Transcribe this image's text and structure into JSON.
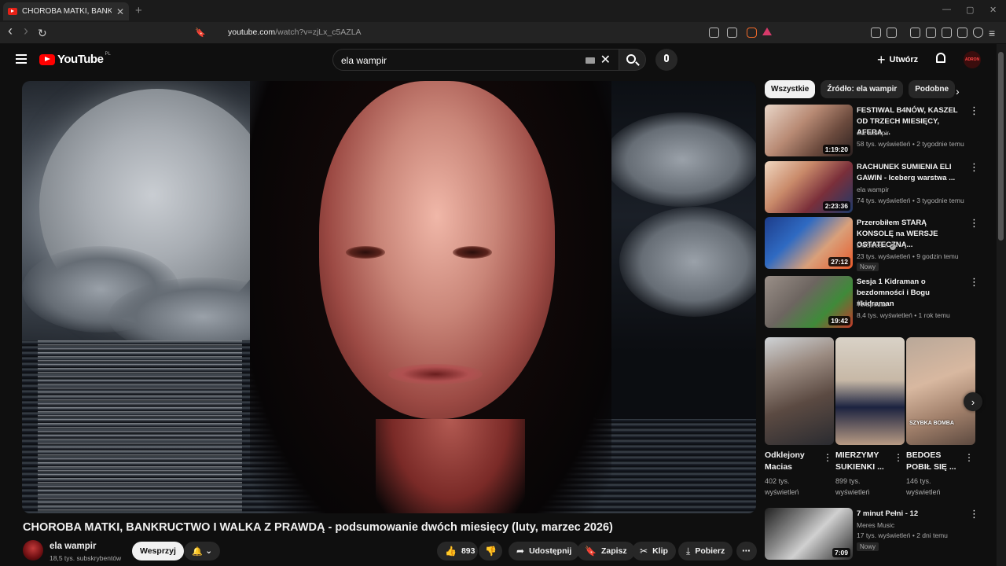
{
  "browser": {
    "tab_title": "CHOROBA MATKI, BANKRUCTW",
    "tab_close": "✕",
    "new_tab": "+",
    "url_domain": "youtube.com",
    "url_path": "/watch?v=zjLx_c5AZLA",
    "min_glyph": "—",
    "max_glyph": "▢",
    "close_glyph": "✕"
  },
  "header": {
    "logo_text": "YouTube",
    "logo_country": "PL",
    "search_value": "ela wampir",
    "clear_glyph": "✕",
    "create_label": "Utwórz",
    "create_icon": "+",
    "avatar_text": "ADRON"
  },
  "video": {
    "title": "CHOROBA MATKI, BANKRUCTWO I WALKA Z PRAWDĄ - podsumowanie dwóch miesięcy (luty, marzec 2026)",
    "channel": "ela wampir",
    "subscribers": "18,5 tys. subskrybentów",
    "support_label": "Wesprzyj",
    "likes": "893",
    "share_label": "Udostępnij",
    "save_label": "Zapisz",
    "clip_label": "Klip",
    "download_label": "Pobierz"
  },
  "icons": {
    "like": "👍",
    "dislike": "👎",
    "share": "➦",
    "save": "🔖",
    "clip": "✂",
    "download": "⤓",
    "more": "⋯",
    "bell": "🔔",
    "chevron": "⌄",
    "back": "‹",
    "forward": "›",
    "reload": "↻",
    "bookmark": "🔖",
    "next": "›",
    "kebab": "⋮"
  },
  "sidebar": {
    "chips": [
      "Wszystkie",
      "Źródło: ela wampir",
      "Podobne"
    ],
    "recommendations": [
      {
        "title": "FESTIWAL B4NÓW, KASZEL OD TRZECH MIESIĘCY, AFERA ...",
        "channel": "ela wampir",
        "meta": "58 tys. wyświetleń • 2 tygodnie temu",
        "duration": "1:19:20",
        "badge": ""
      },
      {
        "title": "RACHUNEK SUMIENIA ELI GAWIN - Iceberg warstwa ...",
        "channel": "ela wampir",
        "meta": "74 tys. wyświetleń • 3 tygodnie temu",
        "duration": "2:23:36",
        "badge": ""
      },
      {
        "title": "Przerobiłem STARĄ KONSOLĘ na WERSJE OSTATECZNĄ...",
        "channel": "DisStream",
        "meta": "23 tys. wyświetleń • 9 godzin temu",
        "duration": "27:12",
        "badge": "Nowy"
      },
      {
        "title": "Sesja 1 Kidraman o bezdomności i Bogu #kidraman",
        "channel": "Terapeuta",
        "meta": "8,4 tys. wyświetleń • 1 rok temu",
        "duration": "19:42",
        "badge": ""
      }
    ],
    "shorts": [
      {
        "title": "Odklejony Macias",
        "views": "402 tys. wyświetleń"
      },
      {
        "title": "MIERZYMY SUKIENKI ...",
        "views": "899 tys. wyświetleń"
      },
      {
        "title": "BEDOES POBIŁ SIĘ ...",
        "views": "146 tys. wyświetleń",
        "overlay": "SZYBKA BOMBA"
      }
    ],
    "last": {
      "title": "7 minut Pełni - 12",
      "channel": "Meres Music",
      "meta": "17 tys. wyświetleń • 2 dni temu",
      "duration": "7:09",
      "badge": "Nowy"
    }
  }
}
